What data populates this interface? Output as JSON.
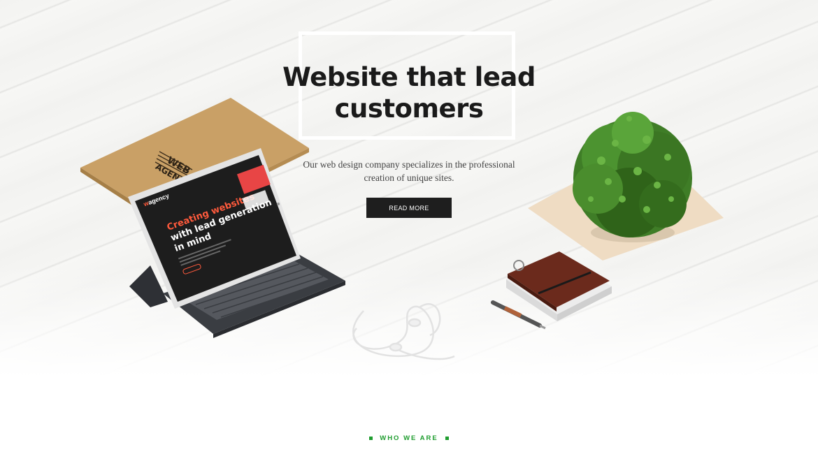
{
  "hero": {
    "title_line1": "Website that lead",
    "title_line2": "customers",
    "subtitle_line1": "Our web design company specializes in the professional",
    "subtitle_line2": "creation of unique sites.",
    "button_label": "READ MORE"
  },
  "mockup": {
    "box_text_line1": "WEB",
    "box_text_line2": "AGENCY",
    "tablet_brand": "agency",
    "tablet_brand_initial": "w",
    "tablet_headline_line1": "Creating websites",
    "tablet_headline_line2": "with lead generation",
    "tablet_headline_line3": "in mind"
  },
  "section": {
    "eyebrow": "WHO WE ARE"
  },
  "colors": {
    "accent_green": "#1f9d2f",
    "dark": "#1e1e1e",
    "tablet_accent": "#ff5a3c"
  }
}
